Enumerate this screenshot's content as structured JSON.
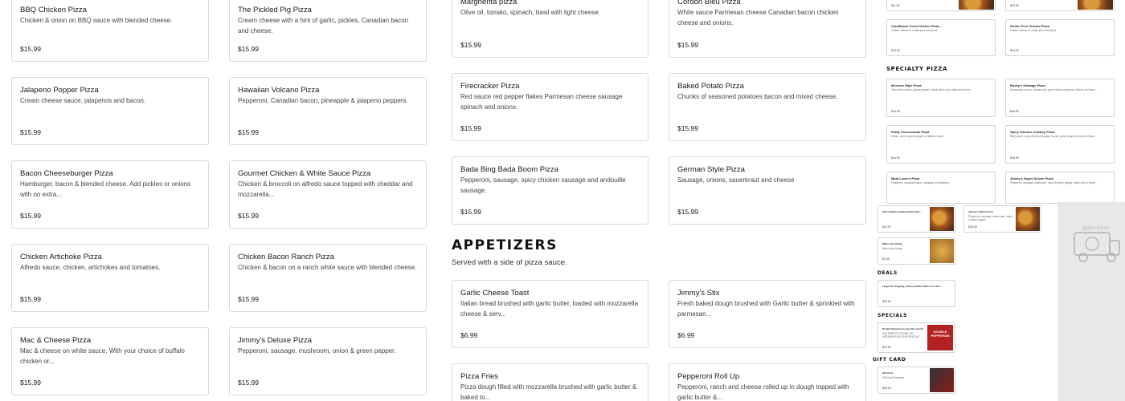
{
  "menu": {
    "col1": [
      {
        "name": "BBQ Chicken Pizza",
        "desc": "Chicken & onion on BBQ sauce with blended cheese.",
        "price": "$15.99"
      },
      {
        "name": "Jalapeno Popper Pizza",
        "desc": "Cream cheese sauce, jalapenos and bacon.",
        "price": "$15.99"
      },
      {
        "name": "Bacon Cheeseburger Pizza",
        "desc": "Hamburger, bacon & blended cheese. Add pickles or onions with no extra...",
        "price": "$15.99"
      },
      {
        "name": "Chicken Artichoke Pizza",
        "desc": "Alfredo sauce, chicken, artichokes and tomatoes.",
        "price": "$15.99"
      },
      {
        "name": "Mac & Cheese Pizza",
        "desc": "Mac & cheese on white sauce. With your choice of buffalo chicken or...",
        "price": "$15.99"
      }
    ],
    "col2": [
      {
        "name": "The Pickled Pig Pizza",
        "desc": "Cream cheese with a hint of garlic, pickles, Canadian bacon and cheese.",
        "price": "$15.99"
      },
      {
        "name": "Hawaiian Volcano Pizza",
        "desc": "Pepperoni, Canadian bacon, pineapple & jalapeno peppers.",
        "price": "$15.99"
      },
      {
        "name": "Gourmet Chicken & White Sauce Pizza",
        "desc": "Chicken & broccoli on alfredo sauce topped with cheddar and mozzarella...",
        "price": "$15.99"
      },
      {
        "name": "Chicken Bacon Ranch Pizza",
        "desc": "Chicken & bacon on a ranch white sauce with blended cheese.",
        "price": "$15.99"
      },
      {
        "name": "Jimmy's Deluxe Pizza",
        "desc": "Pepperoni, sausage, mushroom, onion & green pepper.",
        "price": "$15.99"
      }
    ],
    "col3": [
      {
        "name": "Margherita pizza",
        "desc": "Olive oil, tomato, spinach, basil with light cheese.",
        "price": "$15.99"
      },
      {
        "name": "Firecracker Pizza",
        "desc": "Red sauce red pepper flakes Parmesan cheese sausage spinach and onions.",
        "price": "$15.99"
      },
      {
        "name": "Bada Bing Bada Boom Pizza",
        "desc": "Pepperoni, sausage, spicy chicken sausage and andouille sausage.",
        "price": "$15.99"
      }
    ],
    "col4": [
      {
        "name": "Cordon Bleu Pizza",
        "desc": "White sauce Parmesan cheese Canadian bacon chicken cheese and onions.",
        "price": "$15.99"
      },
      {
        "name": "Baked Potato Pizza",
        "desc": "Chunks of seasoned potatoes bacon and mixed cheese.",
        "price": "$15.99"
      },
      {
        "name": "German Style Pizza",
        "desc": "Sausage, onions, sauerkraut and cheese",
        "price": "$15.99"
      }
    ],
    "appetizers": {
      "heading": "APPETIZERS",
      "subtitle": "Served with a side of pizza sauce.",
      "col3": [
        {
          "name": "Garlic Cheese Toast",
          "desc": "Italian bread brushed with garlic butter, loaded with mozzarella cheese & serv...",
          "price": "$6.99"
        },
        {
          "name": "Pizza Fries",
          "desc": "Pizza dough filled with mozzarella brushed with garlic butter & baked to...",
          "price": ""
        }
      ],
      "col4": [
        {
          "name": "Jimmy's Stix",
          "desc": "Fresh baked dough brushed with Garlic butter & sprinkled with parmesan...",
          "price": "$6.99"
        },
        {
          "name": "Pepperoni Roll Up",
          "desc": "Pepperoni, ranch and cheese rolled up in dough topped with garlic butter &...",
          "price": ""
        }
      ]
    }
  },
  "preview": {
    "top_prices": [
      "$11.99",
      "$10.99"
    ],
    "row1": [
      {
        "name": "Cauliflower Crust Cheese Pizza...",
        "desc": "Classic cheese or create your own pizza.",
        "price": "$15.99"
      },
      {
        "name": "Gluten Free Cheese Pizza",
        "desc": "Classic cheese or create your own pizza.",
        "price": "$14.49"
      }
    ],
    "section_specialty": "SPECIALTY PIZZA",
    "specialty": [
      {
        "name": "Mexican Style Pizza",
        "desc": "Taco meat, onions, green peppers, black olives, taco chips and mixed...",
        "price": "$16.99"
      },
      {
        "name": "Rocky's Garbage Pizza",
        "desc": "Hamburger, onions, mushrooms, green olives, pepperoni, bacon, and three...",
        "price": "$16.99"
      },
      {
        "name": "Philly Cheesesteak Pizza",
        "desc": "Steak, onion & green pepper on alfredo sauce.",
        "price": "$16.99"
      },
      {
        "name": "Spicy Chicken Cowboy Pizza",
        "desc": "BBQ sauce, spicy chicken sausage, bacon, green peppers, onions & bana...",
        "price": "$16.99"
      },
      {
        "name": "Meat Lover's Pizza",
        "desc": "Pepperoni, canadian bacon, sausage & hamburger.",
        "price": ""
      },
      {
        "name": "Jimmy's Super Deluxe Pizza",
        "desc": "Pepperoni, sausage, mushroom, onion & green pepper, black olive & green...",
        "price": ""
      }
    ],
    "take_n_bake": [
      {
        "name": "Take N' Bake Topping Pizza Pick...",
        "price": "$11.99"
      },
      {
        "name": "Jimmy's Deluxe Pizza",
        "desc": "Pepperoni, sausage, mushroom, onion & green pepper.",
        "price": "$15.49"
      }
    ],
    "hot_honey": {
      "name": "Mike's Hot Honey",
      "desc": "Mike's Hot Honey",
      "price": "$1.99"
    },
    "section_deals": "DEALS",
    "deal": {
      "name": "Large One Topping, Cheesy Garlic Sticks & 2 Liter...",
      "price": "$26.99"
    },
    "section_specials": "SPECIALS",
    "special": {
      "name": "Double Pepperoni Large this month",
      "desc": "\"NO SUBSTITUTIONS OR UPGRADES ON THIS SPECIAL\"",
      "price": "$12.99",
      "badge": "DOUBLE PEPPERONI"
    },
    "section_gift": "GIFT CARD",
    "gift": {
      "name": "Gift Card",
      "desc": "Gift Card Purchase",
      "price": "$25.00"
    },
    "brand_text": "pizza truck"
  }
}
